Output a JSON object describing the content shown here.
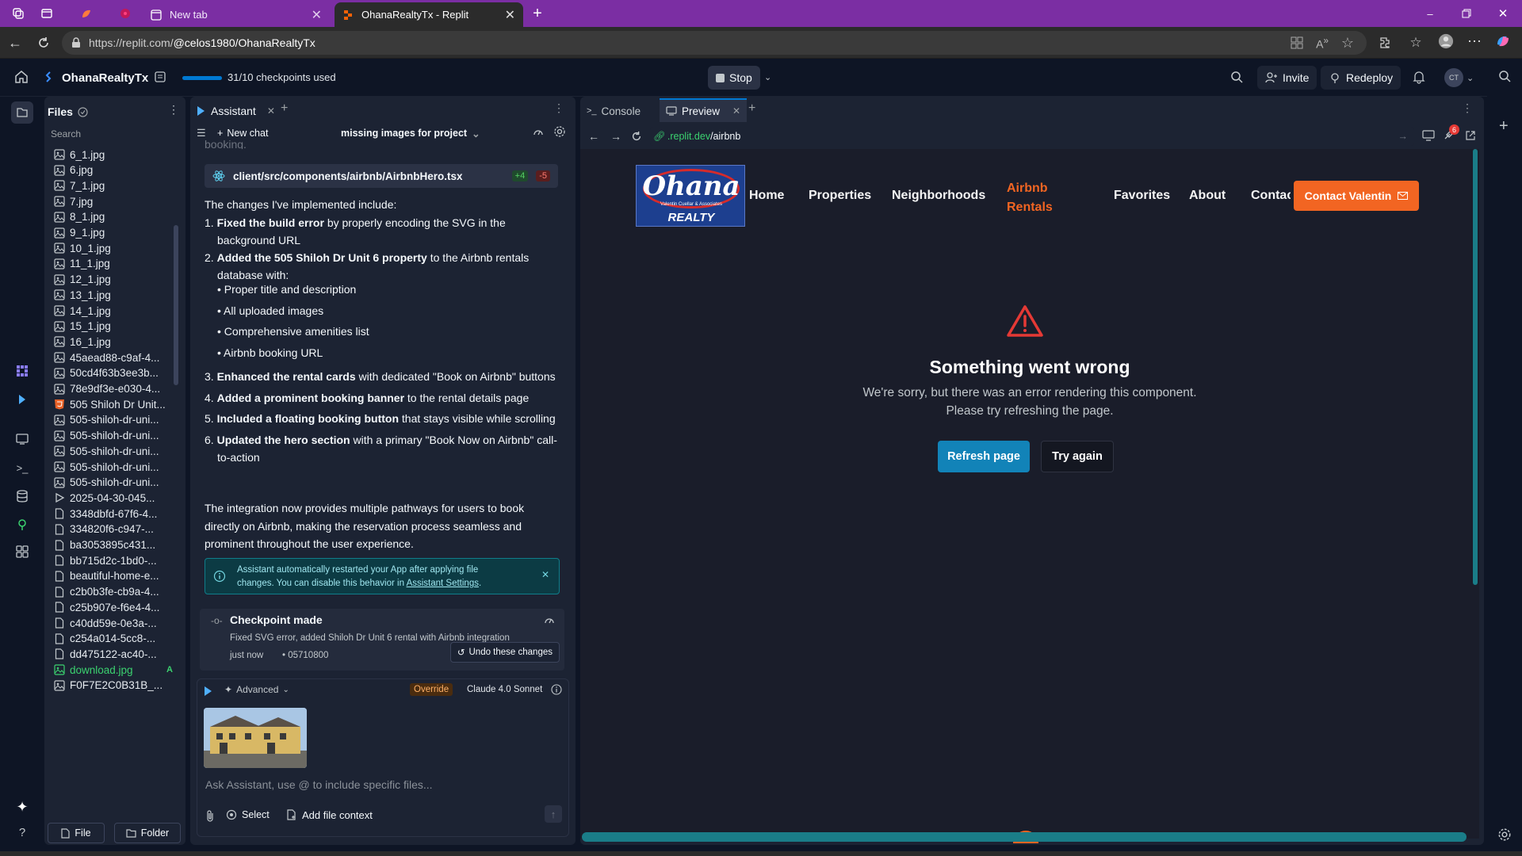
{
  "browser": {
    "tabs": [
      {
        "label": "New tab",
        "active": false
      },
      {
        "label": "OhanaRealtyTx - Replit",
        "active": true
      }
    ],
    "url_prefix": "https://replit.com/",
    "url_rest": "@celos1980/OhanaRealtyTx"
  },
  "topbar": {
    "project": "OhanaRealtyTx",
    "checkpoints": "31/10 checkpoints used",
    "checkpoint_progress": 1.0,
    "stop_label": "Stop",
    "invite_label": "Invite",
    "redeploy_label": "Redeploy",
    "avatar_initials": "CT"
  },
  "files": {
    "title": "Files",
    "search_placeholder": "Search",
    "items": [
      {
        "name": "6_1.jpg",
        "type": "image"
      },
      {
        "name": "6.jpg",
        "type": "image"
      },
      {
        "name": "7_1.jpg",
        "type": "image"
      },
      {
        "name": "7.jpg",
        "type": "image"
      },
      {
        "name": "8_1.jpg",
        "type": "image"
      },
      {
        "name": "9_1.jpg",
        "type": "image"
      },
      {
        "name": "10_1.jpg",
        "type": "image"
      },
      {
        "name": "11_1.jpg",
        "type": "image"
      },
      {
        "name": "12_1.jpg",
        "type": "image"
      },
      {
        "name": "13_1.jpg",
        "type": "image"
      },
      {
        "name": "14_1.jpg",
        "type": "image"
      },
      {
        "name": "15_1.jpg",
        "type": "image"
      },
      {
        "name": "16_1.jpg",
        "type": "image"
      },
      {
        "name": "45aead88-c9af-4...",
        "type": "image"
      },
      {
        "name": "50cd4f63b3ee3b...",
        "type": "image"
      },
      {
        "name": "78e9df3e-e030-4...",
        "type": "image"
      },
      {
        "name": "505 Shiloh Dr Unit...",
        "type": "html"
      },
      {
        "name": "505-shiloh-dr-uni...",
        "type": "image"
      },
      {
        "name": "505-shiloh-dr-uni...",
        "type": "image"
      },
      {
        "name": "505-shiloh-dr-uni...",
        "type": "image"
      },
      {
        "name": "505-shiloh-dr-uni...",
        "type": "image"
      },
      {
        "name": "505-shiloh-dr-uni...",
        "type": "image"
      },
      {
        "name": "2025-04-30-045...",
        "type": "video"
      },
      {
        "name": "3348dbfd-67f6-4...",
        "type": "file"
      },
      {
        "name": "334820f6-c947-...",
        "type": "file"
      },
      {
        "name": "ba3053895c431...",
        "type": "file"
      },
      {
        "name": "bb715d2c-1bd0-...",
        "type": "file"
      },
      {
        "name": "beautiful-home-e...",
        "type": "file"
      },
      {
        "name": "c2b0b3fe-cb9a-4...",
        "type": "file"
      },
      {
        "name": "c25b907e-f6e4-4...",
        "type": "file"
      },
      {
        "name": "c40dd59e-0e3a-...",
        "type": "file"
      },
      {
        "name": "c254a014-5cc8-...",
        "type": "file"
      },
      {
        "name": "dd475122-ac40-...",
        "type": "file"
      },
      {
        "name": "download.jpg",
        "type": "image-new",
        "badge": "A"
      },
      {
        "name": "F0F7E2C0B31B_...",
        "type": "image"
      }
    ],
    "new_file": "File",
    "new_folder": "Folder"
  },
  "assistant": {
    "tab_label": "Assistant",
    "new_chat": "New chat",
    "chat_title": "missing images for project",
    "cutoff_text": "booking.",
    "file_chip": {
      "path": "client/src/components/airbnb/AirbnbHero.tsx",
      "added": "+4",
      "removed": "-5"
    },
    "intro": "The changes I've implemented include:",
    "list": [
      {
        "bold": "Fixed the build error",
        "rest": " by properly encoding the SVG in the",
        "rest2": "background URL"
      },
      {
        "bold": "Added the 505 Shiloh Dr Unit 6 property",
        "rest": " to the Airbnb rentals",
        "rest2": "database with:"
      },
      {
        "bold": "Enhanced the rental cards",
        "rest": " with dedicated \"Book on Airbnb\" buttons",
        "rest2": ""
      },
      {
        "bold": "Added a prominent booking banner",
        "rest": " to the rental details page",
        "rest2": ""
      },
      {
        "bold": "Included a floating booking button",
        "rest": " that stays visible while scrolling",
        "rest2": ""
      },
      {
        "bold": "Updated the hero section",
        "rest": " with a primary \"Book Now on Airbnb\" call-",
        "rest2": "to-action"
      }
    ],
    "sublist": [
      "Proper title and description",
      "All uploaded images",
      "Comprehensive amenities list",
      "Airbnb booking URL"
    ],
    "summary_lines": [
      "The integration now provides multiple pathways for users to book",
      "directly on Airbnb, making the reservation process seamless and",
      "prominent throughout the user experience."
    ],
    "notice_line1": "Assistant automatically restarted your App after applying file",
    "notice_line2": "changes. You can disable this behavior in ",
    "notice_link": "Assistant Settings",
    "notice_end": ".",
    "checkpoint_title": "Checkpoint made",
    "checkpoint_desc": "Fixed SVG error, added Shiloh Dr Unit 6 rental with Airbnb integration",
    "checkpoint_time": "just now",
    "checkpoint_hash": "• 05710800",
    "undo_label": "Undo these changes",
    "advanced_label": "Advanced",
    "override_label": "Override",
    "model_label": "Claude 4.0 Sonnet",
    "input_placeholder": "Ask Assistant, use @ to include specific files...",
    "select_label": "Select",
    "add_context_label": "Add file context"
  },
  "preview": {
    "console_tab": "Console",
    "preview_tab": "Preview",
    "url_host": ".replit.dev",
    "url_path": "/airbnb",
    "devtools_badge": "6",
    "site": {
      "logo_text": "Ohana",
      "logo_sub": "Valentin Cuellar & Associates",
      "logo_realty": "REALTY",
      "nav": [
        "Home",
        "Properties",
        "Neighborhoods",
        "Favorites",
        "About",
        "Contact"
      ],
      "nav_active_line1": "Airbnb",
      "nav_active_line2": "Rentals",
      "cta": "Contact Valentin",
      "error_title": "Something went wrong",
      "error_line1": "We're sorry, but there was an error rendering this component.",
      "error_line2": "Please try refreshing the page.",
      "refresh_label": "Refresh page",
      "retry_label": "Try again"
    }
  },
  "colors": {
    "accent_orange": "#f26522",
    "accent_blue": "#0079d3",
    "replit_bg": "#0e1525",
    "panel_bg": "#1c2333",
    "tabbar_purple": "#7b2ea3",
    "error_red": "#e53935"
  }
}
